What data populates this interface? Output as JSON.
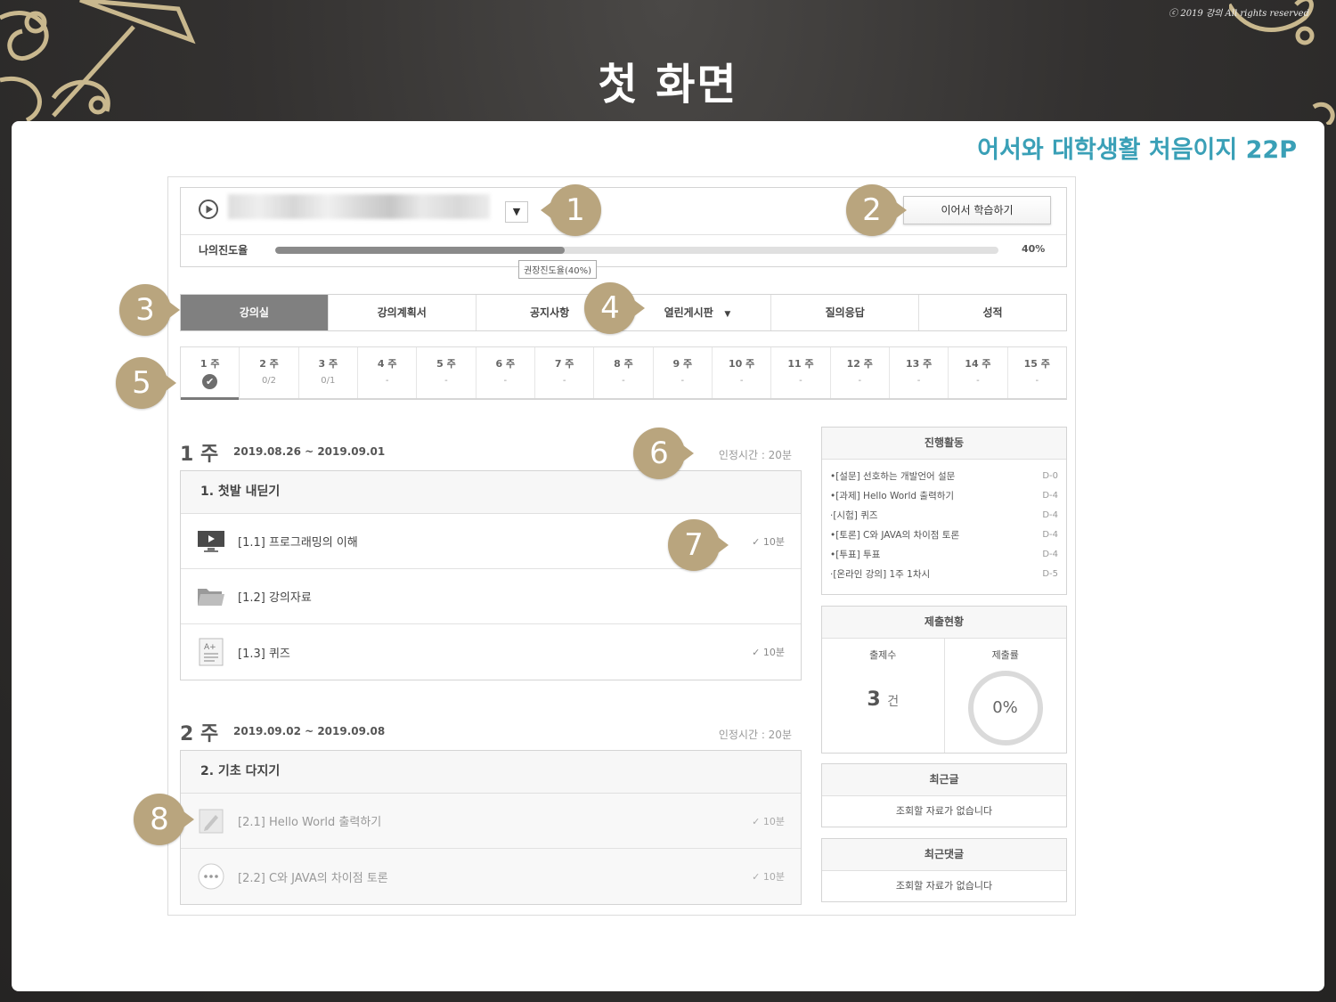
{
  "slide": {
    "title": "첫 화면",
    "copyright": "ⓒ 2019 강의 All rights reserved",
    "book_ref": "어서와 대학생활 처음이지 22P"
  },
  "course_bar": {
    "resume_button": "이어서 학습하기",
    "progress_label": "나의진도율",
    "progress_value": 0.4,
    "progress_text": "40%",
    "tooltip": "권장진도율(40%)"
  },
  "main_tabs": [
    {
      "label": "강의실",
      "active": true
    },
    {
      "label": "강의계획서",
      "active": false
    },
    {
      "label": "공지사항",
      "active": false
    },
    {
      "label": "열린게시판",
      "active": false
    },
    {
      "label": "질의응답",
      "active": false
    },
    {
      "label": "성적",
      "active": false
    }
  ],
  "week_tabs": [
    {
      "name": "1 주",
      "sub": "✔",
      "done": true
    },
    {
      "name": "2 주",
      "sub": "0/2"
    },
    {
      "name": "3 주",
      "sub": "0/1"
    },
    {
      "name": "4 주",
      "sub": "-"
    },
    {
      "name": "5 주",
      "sub": "-"
    },
    {
      "name": "6 주",
      "sub": "-"
    },
    {
      "name": "7 주",
      "sub": "-"
    },
    {
      "name": "8 주",
      "sub": "-"
    },
    {
      "name": "9 주",
      "sub": "-"
    },
    {
      "name": "10 주",
      "sub": "-"
    },
    {
      "name": "11 주",
      "sub": "-"
    },
    {
      "name": "12 주",
      "sub": "-"
    },
    {
      "name": "13 주",
      "sub": "-"
    },
    {
      "name": "14 주",
      "sub": "-"
    },
    {
      "name": "15 주",
      "sub": "-"
    }
  ],
  "weeks": [
    {
      "title": "1 주",
      "dates": "2019.08.26 ~ 2019.09.01",
      "credit_time": "인정시간 : 20분",
      "module": "1. 첫발 내딛기",
      "items": [
        {
          "icon": "video-icon",
          "label": "[1.1] 프로그래밍의 이해",
          "done": "✓ 10분"
        },
        {
          "icon": "folder-icon",
          "label": "[1.2] 강의자료",
          "done": ""
        },
        {
          "icon": "quiz-icon",
          "label": "[1.3] 퀴즈",
          "done": "✓ 10분"
        }
      ]
    },
    {
      "title": "2 주",
      "dates": "2019.09.02 ~ 2019.09.08",
      "credit_time": "인정시간 : 20분",
      "module": "2. 기초 다지기",
      "items": [
        {
          "icon": "assignment-icon",
          "label": "[2.1] Hello World 출력하기",
          "done": "✓ 10분"
        },
        {
          "icon": "discussion-icon",
          "label": "[2.2] C와 JAVA의 차이점 토론",
          "done": "✓ 10분"
        }
      ]
    }
  ],
  "activities": {
    "title": "진행활동",
    "items": [
      {
        "label": "•[설문] 선호하는 개발언어 설문",
        "dday": "D-0"
      },
      {
        "label": "•[과제] Hello World 출력하기",
        "dday": "D-4"
      },
      {
        "label": "·[시험] 퀴즈",
        "dday": "D-4"
      },
      {
        "label": "•[토론] C와 JAVA의 차이점 토론",
        "dday": "D-4"
      },
      {
        "label": "•[투표] 투표",
        "dday": "D-4"
      },
      {
        "label": "·[온라인 강의] 1주 1차시",
        "dday": "D-5"
      }
    ]
  },
  "submissions": {
    "title": "제출현황",
    "count_label": "출제수",
    "count_value": "3",
    "count_unit": "건",
    "rate_label": "제출률",
    "rate_value": "0%"
  },
  "recent_posts": {
    "title": "최근글",
    "empty": "조회할 자료가 없습니다"
  },
  "recent_comments": {
    "title": "최근댓글",
    "empty": "조회할 자료가 없습니다"
  },
  "callouts": [
    "1",
    "2",
    "3",
    "4",
    "5",
    "6",
    "7",
    "8"
  ],
  "colors": {
    "accent": "#3aa0b7",
    "badge": "#b9a57e",
    "active_tab": "#808080"
  }
}
